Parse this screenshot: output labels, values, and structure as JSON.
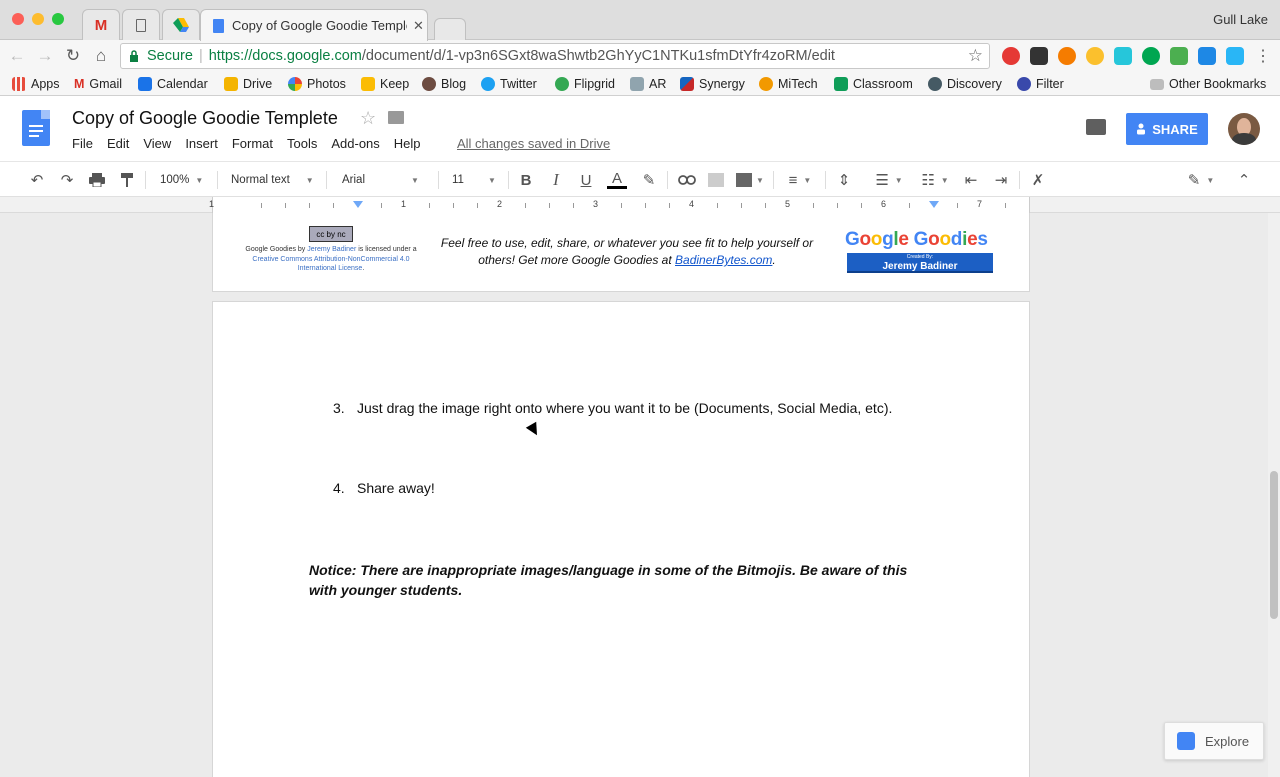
{
  "browser": {
    "profile_name": "Gull Lake",
    "tabs": [
      {
        "label": "",
        "icon": "gmail-icon"
      },
      {
        "label": "",
        "icon": "document-icon"
      },
      {
        "label": "",
        "icon": "drive-icon"
      },
      {
        "label": "Copy of Google Goodie Temple",
        "icon": "docs-icon"
      }
    ],
    "omnibox": {
      "secure_label": "Secure",
      "separator": "|",
      "url_host": "https://docs.google.com",
      "url_path": "/document/d/1-vp3n6SGxt8waShwtb2GhYyC1NTKu1sfmDtYfr4zoRM/edit"
    },
    "bookmarks": [
      {
        "label": "Apps",
        "color": "#5f6368"
      },
      {
        "label": "Gmail",
        "color": "#d93025"
      },
      {
        "label": "Calendar",
        "color": "#1a73e8"
      },
      {
        "label": "Drive",
        "color": "#f4b400"
      },
      {
        "label": "Photos",
        "color": "#ea4335"
      },
      {
        "label": "Keep",
        "color": "#fbbc04"
      },
      {
        "label": "Blog",
        "color": "#6d4c41"
      },
      {
        "label": "Twitter",
        "color": "#1da1f2"
      },
      {
        "label": "Flipgrid",
        "color": "#34a853"
      },
      {
        "label": "AR",
        "color": "#607d8b"
      },
      {
        "label": "Synergy",
        "color": "#c62828"
      },
      {
        "label": "MiTech",
        "color": "#f29900"
      },
      {
        "label": "Classroom",
        "color": "#0f9d58"
      },
      {
        "label": "Discovery",
        "color": "#455a64"
      },
      {
        "label": "Filter",
        "color": "#3949ab"
      }
    ],
    "other_bookmarks": "Other Bookmarks"
  },
  "docs": {
    "title": "Copy of Google Goodie Templete",
    "menu": [
      "File",
      "Edit",
      "View",
      "Insert",
      "Format",
      "Tools",
      "Add-ons",
      "Help"
    ],
    "saved_status": "All changes saved in Drive",
    "share_label": "SHARE"
  },
  "toolbar": {
    "zoom": "100%",
    "style": "Normal text",
    "font": "Arial",
    "size": "11"
  },
  "ruler": {
    "numbers": [
      "1",
      "1",
      "2",
      "3",
      "4",
      "5",
      "6",
      "7"
    ]
  },
  "document": {
    "footer": {
      "cc_badge": "cc by nc",
      "license_line1": "Google Goodies by ",
      "license_author": "Jeremy Badiner",
      "license_line2": " is licensed under a ",
      "license_link": "Creative Commons Attribution-NonCommercial 4.0 International License",
      "license_end": ".",
      "note_text": "Feel free to use, edit, share, or whatever you see fit to help yourself or others!  Get more Google Goodies at ",
      "note_link": "BadinerBytes.com",
      "note_end": ".",
      "logo_title": "Google Goodies",
      "logo_created_by": "Created By:",
      "logo_author": "Jeremy Badiner"
    },
    "list": [
      {
        "num": "3.",
        "text": "Just drag the image right onto where you want it to be (Documents, Social Media, etc)."
      },
      {
        "num": "4.",
        "text": "Share away!"
      }
    ],
    "notice": "Notice: There are inappropriate images/language in some of the Bitmojis. Be aware of this with younger students."
  },
  "explore_label": "Explore"
}
